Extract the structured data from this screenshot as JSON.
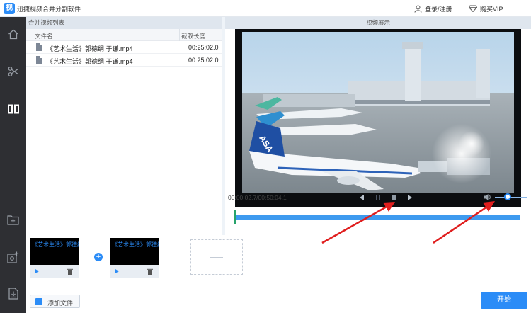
{
  "app": {
    "logo_char": "视",
    "title": "迅捷视频合并分割软件"
  },
  "header": {
    "login_label": "登录/注册",
    "vip_label": "购买VIP"
  },
  "list_panel": {
    "title": "合并视频列表",
    "columns": {
      "name": "文件名",
      "length": "截取长度"
    },
    "files": [
      {
        "name": "《艺术生活》郭德纲 于谦.mp4",
        "length": "00:25:02.0"
      },
      {
        "name": "《艺术生活》郭德纲 于谦.mp4",
        "length": "00:25:02.0"
      }
    ]
  },
  "preview_panel": {
    "title": "视频展示",
    "time_display": "00:00:02.7/00:50:04.1",
    "volume_level": 0.4,
    "progress": 0.001
  },
  "clips": [
    {
      "title": "《艺术生活》郭德纲"
    },
    {
      "title": "《艺术生活》郭德纲"
    }
  ],
  "bottom": {
    "add_file_label": "添加文件",
    "start_label": "开始"
  },
  "colors": {
    "accent": "#2b8cf7",
    "sidebar": "#2e2f33",
    "timeline": "#3d9aef",
    "arrow": "#e01e1e"
  }
}
